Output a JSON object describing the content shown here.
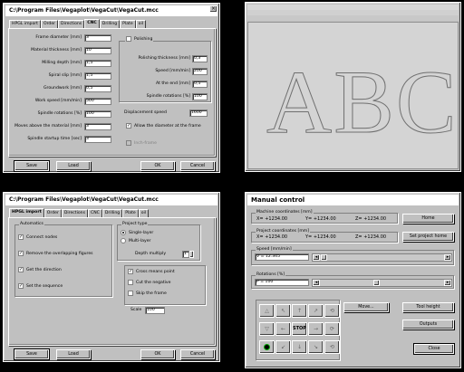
{
  "win1": {
    "title": "C:\\Program Files\\Vegaplot\\VegaCut\\VegaCut.mcc",
    "tabs": [
      "HPGL import",
      "Order",
      "Directions",
      "CNC",
      "Drilling",
      "Plate",
      "oil"
    ],
    "fields": [
      {
        "label": "Frame diameter [mm]",
        "value": "3"
      },
      {
        "label": "Material thickness [mm]",
        "value": "10"
      },
      {
        "label": "Milling depth [mm]",
        "value": "1,5"
      },
      {
        "label": "Spiral slip [mm]",
        "value": "1,5"
      },
      {
        "label": "Groundwork [mm]",
        "value": "0,5"
      },
      {
        "label": "Work speed [mm/min]",
        "value": "500"
      },
      {
        "label": "Spindle rotations [%]",
        "value": "100"
      },
      {
        "label": "Moves above the material [mm]",
        "value": "3"
      },
      {
        "label": "Spindle startup time [sec]",
        "value": "3"
      }
    ],
    "polishing": {
      "label": "Polishing"
    },
    "polish_fields": [
      {
        "label": "Polishing thickness [mm]",
        "value": "0,3"
      },
      {
        "label": "Speed [mm/min]",
        "value": "200"
      },
      {
        "label": "At the end [mm]",
        "value": "0,5"
      },
      {
        "label": "Spindle rotations [%]",
        "value": "100"
      }
    ],
    "displacement": {
      "label": "Displacement speed",
      "value": "1600"
    },
    "allow": {
      "label": "Allow the diameter at the frame"
    },
    "rh": {
      "label": "Inch-frame"
    },
    "buttons": {
      "save": "Save",
      "load": "Load",
      "ok": "OK",
      "cancel": "Cancel"
    }
  },
  "win2": {
    "text": "ABC"
  },
  "win3": {
    "title": "C:\\Program Files\\Vegaplot\\VegaCut\\VegaCut.mcc",
    "tabs": [
      "HPGL import",
      "Order",
      "Directions",
      "CNC",
      "Drilling",
      "Plate",
      "oil"
    ],
    "automatics_title": "Automatics",
    "checks": [
      "Connect nodes",
      "Remove the overlapping figures",
      "Get the direction",
      "Set the sequence"
    ],
    "project_type": "Project type",
    "single": "Single-layer",
    "multi": "Multi-layer",
    "depth_label": "Depth multiply",
    "depth_value": "1",
    "opts": [
      {
        "label": "Cross means point",
        "checked": true
      },
      {
        "label": "Cut the negative",
        "checked": false
      },
      {
        "label": "Skip the frame",
        "checked": false
      }
    ],
    "scale_label": "Scale",
    "scale_value": "100",
    "buttons": {
      "save": "Save",
      "load": "Load",
      "ok": "OK",
      "cancel": "Cancel"
    }
  },
  "win4": {
    "title": "Manual control",
    "machine_title": "Machine coordinates [mm]",
    "machine": {
      "x": "X= +1234.00",
      "y": "Y= +1234.00",
      "z": "Z= +1234.00"
    },
    "home": "Home",
    "project_title": "Project coordinates [mm]",
    "project": {
      "x": "X= +1234.00",
      "y": "Y= +1234.00",
      "z": "Z= +1234.00"
    },
    "set_home": "Set project home",
    "speed_title": "Speed [mm/min]",
    "speed_value": "V =   12.345",
    "rot_title": "Rotations [%]",
    "rot_value": "P =   100",
    "move": "Move...",
    "toolheight": "Tool height",
    "outputs": "Outputs",
    "close": "Close",
    "stop": "STOP"
  }
}
